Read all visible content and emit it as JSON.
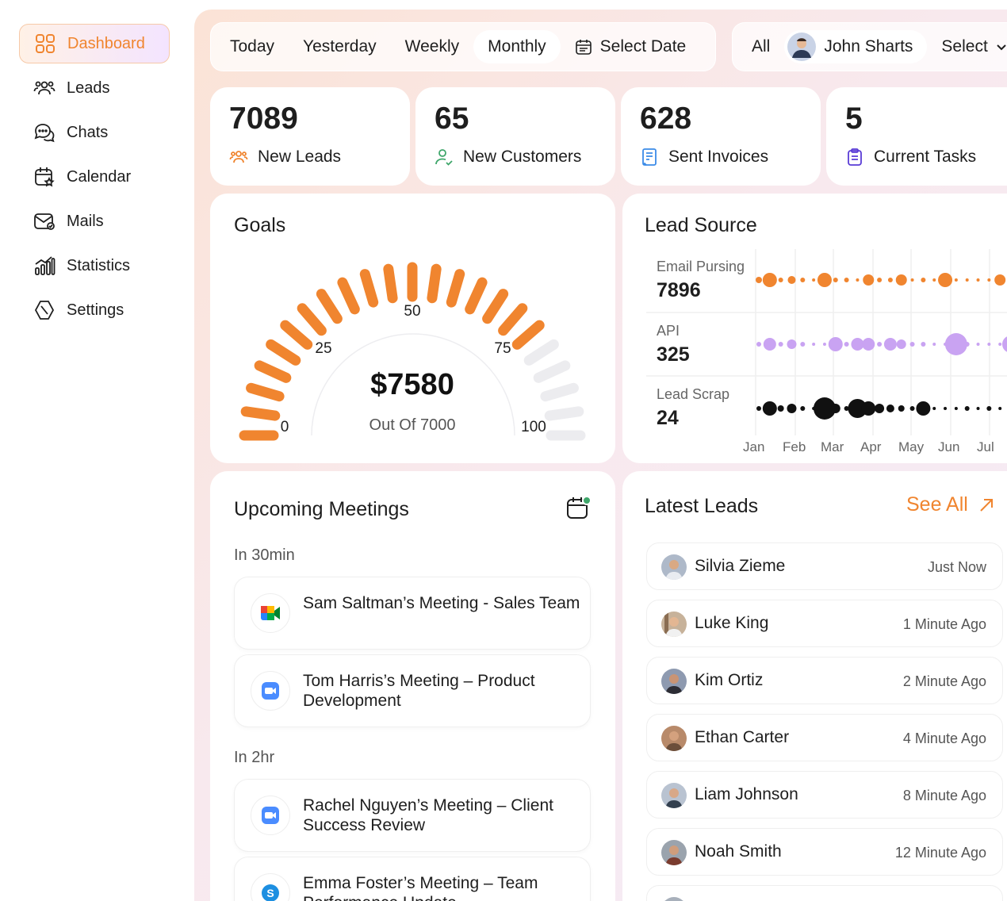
{
  "sidebar": {
    "items": [
      {
        "label": "Dashboard",
        "icon": "grid-icon",
        "active": true
      },
      {
        "label": "Leads",
        "icon": "users-icon"
      },
      {
        "label": "Chats",
        "icon": "chat-icon"
      },
      {
        "label": "Calendar",
        "icon": "calendar-icon"
      },
      {
        "label": "Mails",
        "icon": "mail-icon"
      },
      {
        "label": "Statistics",
        "icon": "bar-chart-icon"
      },
      {
        "label": "Settings",
        "icon": "settings-icon"
      }
    ]
  },
  "filters": {
    "periods": [
      "Today",
      "Yesterday",
      "Weekly",
      "Monthly"
    ],
    "active_period": "Monthly",
    "select_date": "Select Date",
    "all": "All",
    "user_name": "John Sharts",
    "select": "Select"
  },
  "stats": [
    {
      "value": "7089",
      "label": "New Leads",
      "icon": "users-icon"
    },
    {
      "value": "65",
      "label": "New Customers",
      "icon": "user-check-icon"
    },
    {
      "value": "628",
      "label": "Sent Invoices",
      "icon": "invoice-icon"
    },
    {
      "value": "5",
      "label": "Current Tasks",
      "icon": "clipboard-icon"
    }
  ],
  "goals": {
    "title": "Goals",
    "amount": "$7580",
    "subtitle": "Out Of 7000",
    "ticks": [
      "0",
      "25",
      "50",
      "75",
      "100"
    ],
    "progress_fraction": 0.8,
    "accent": "#f0852f",
    "track": "#ececef"
  },
  "lead_source": {
    "title": "Lead Source",
    "sources": [
      {
        "label": "Email Pursing",
        "value": "7896",
        "color": "#f0852f"
      },
      {
        "label": "API",
        "value": "325",
        "color": "#c9a3f2"
      },
      {
        "label": "Lead Scrap",
        "value": "24",
        "color": "#111111"
      }
    ],
    "months": [
      "Jan",
      "Feb",
      "Mar",
      "Apr",
      "May",
      "Jun",
      "Jul"
    ]
  },
  "meetings": {
    "title": "Upcoming Meetings",
    "groups": [
      {
        "label": "In 30min",
        "items": [
          {
            "text": "Sam Saltman’s Meeting - Sales Team",
            "app": "google-meet-icon"
          },
          {
            "text": "Tom Harris’s Meeting – Product Development",
            "app": "zoom-icon"
          }
        ]
      },
      {
        "label": "In 2hr",
        "items": [
          {
            "text": "Rachel Nguyen’s Meeting – Client Success Review",
            "app": "zoom-icon"
          },
          {
            "text": "Emma Foster’s Meeting – Team Performance Update",
            "app": "skype-icon"
          }
        ]
      }
    ]
  },
  "latest_leads": {
    "title": "Latest Leads",
    "see_all": "See All",
    "items": [
      {
        "name": "Silvia Zieme",
        "time": "Just Now"
      },
      {
        "name": "Luke King",
        "time": "1 Minute Ago"
      },
      {
        "name": "Kim Ortiz",
        "time": "2 Minute Ago"
      },
      {
        "name": "Ethan Carter",
        "time": "4 Minute Ago"
      },
      {
        "name": "Liam Johnson",
        "time": "8 Minute Ago"
      },
      {
        "name": "Noah Smith",
        "time": "12 Minute Ago"
      }
    ]
  }
}
